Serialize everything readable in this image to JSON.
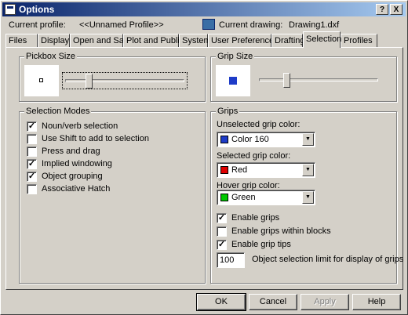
{
  "window": {
    "title": "Options",
    "help_btn": "?",
    "close_btn": "X"
  },
  "profile": {
    "current_profile_label": "Current profile:",
    "current_profile_value": "<<Unnamed Profile>>",
    "current_drawing_label": "Current drawing:",
    "current_drawing_value": "Drawing1.dxf"
  },
  "tabs": [
    "Files",
    "Display",
    "Open and Save",
    "Plot and Publish",
    "System",
    "User Preferences",
    "Drafting",
    "Selection",
    "Profiles"
  ],
  "active_tab": "Selection",
  "pickbox": {
    "legend": "Pickbox Size",
    "slider_level": 0.18
  },
  "grip_size": {
    "legend": "Grip Size",
    "slider_level": 0.22
  },
  "selection_modes": {
    "legend": "Selection Modes",
    "items": [
      {
        "label": "Noun/verb selection",
        "checked": true
      },
      {
        "label": "Use Shift to add to selection",
        "checked": false
      },
      {
        "label": "Press and drag",
        "checked": false
      },
      {
        "label": "Implied windowing",
        "checked": true
      },
      {
        "label": "Object grouping",
        "checked": true
      },
      {
        "label": "Associative Hatch",
        "checked": false
      }
    ]
  },
  "grips": {
    "legend": "Grips",
    "unselected_label": "Unselected grip color:",
    "unselected_value": "Color 160",
    "unselected_color": "#1e3cc8",
    "selected_label": "Selected grip color:",
    "selected_value": "Red",
    "selected_color": "#e00000",
    "hover_label": "Hover grip color:",
    "hover_value": "Green",
    "hover_color": "#00c800",
    "checks": [
      {
        "label": "Enable grips",
        "checked": true
      },
      {
        "label": "Enable grips within blocks",
        "checked": false
      },
      {
        "label": "Enable grip tips",
        "checked": true
      }
    ],
    "limit_value": "100",
    "limit_label": "Object selection limit for display of grips"
  },
  "buttons": {
    "ok": "OK",
    "cancel": "Cancel",
    "apply": "Apply",
    "help": "Help"
  },
  "colors": {
    "titlebar_start": "#0a246a",
    "face": "#d4d0c8"
  }
}
